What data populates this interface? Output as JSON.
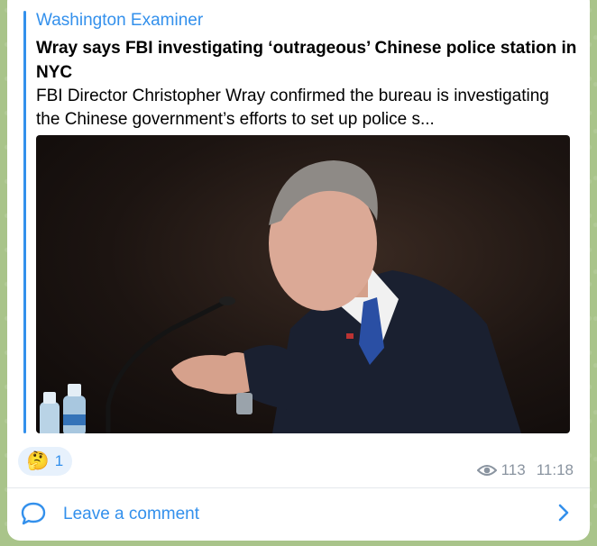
{
  "preview": {
    "site_name": "Washington Examiner",
    "headline": "Wray says FBI investigating ‘outrageous’ Chinese police station in NYC",
    "description": "FBI Director Christopher Wray confirmed the bureau is investigating the Chinese government’s efforts to set up police s..."
  },
  "reaction": {
    "emoji": "🤔",
    "count": "1"
  },
  "meta": {
    "views": "113",
    "time": "11:18",
    "icon": "eye-icon"
  },
  "comment": {
    "label": "Leave a comment",
    "icon": "comment-bubble-icon",
    "chevron": "chevron-right-icon"
  },
  "colors": {
    "accent": "#3390ec",
    "muted": "#8a94a0",
    "background": "#a9c48a"
  }
}
